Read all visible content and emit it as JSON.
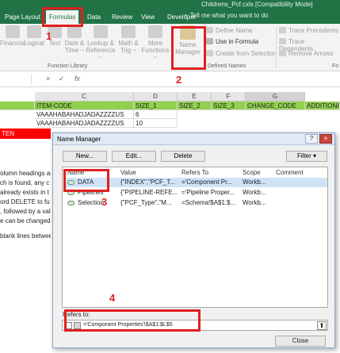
{
  "window": {
    "title": "Childrens_Pcf.cxls [Compatibility Mode]"
  },
  "ribbon": {
    "tabs": [
      "Page Layout",
      "Formulas",
      "Data",
      "Review",
      "View",
      "Developer"
    ],
    "active_tab": "Formulas",
    "tell_me": "Tell me what you want to do",
    "function_library": {
      "label": "Function Library",
      "items": [
        {
          "line1": "Financial",
          "line2": ""
        },
        {
          "line1": "Logical",
          "line2": ""
        },
        {
          "line1": "Text",
          "line2": ""
        },
        {
          "line1": "Date &",
          "line2": "Time ~"
        },
        {
          "line1": "Lookup &",
          "line2": "Reference ~"
        },
        {
          "line1": "Math &",
          "line2": "Trig ~"
        },
        {
          "line1": "More",
          "line2": "Functions ~"
        }
      ]
    },
    "defined_names": {
      "label": "Defined Names",
      "name_manager_line1": "Name",
      "name_manager_line2": "Manager",
      "define_name": "Define Name",
      "use_in_formula": "Use in Formula",
      "create_from_selection": "Create from Selection"
    },
    "formula_auditing": {
      "trace_precedents": "Trace Precedents",
      "trace_dependents": "Trace Dependents",
      "remove_arrows": "Remove Arrows"
    },
    "right_label": "Fo"
  },
  "formula_bar": {
    "fx": "fx",
    "cancel": "×",
    "enter": "✓"
  },
  "sheet": {
    "columns": [
      "C",
      "D",
      "E",
      "F",
      "G"
    ],
    "header_row": [
      "ITEM-CODE",
      "SIZE_1",
      "SIZE_2",
      "SIZE_3",
      "CHANGE_CODE",
      "ADDITIONA"
    ],
    "rows": [
      {
        "item": "VAAAHABAHADJADAZZZZUS",
        "size1": "6"
      },
      {
        "item": "VAAAHABAHADJADAZZZZUS",
        "size1": "10"
      }
    ],
    "red_text": "TEN",
    "left_lines": [
      "olumn headings as",
      "ch is found, any c",
      "already exists in t",
      "ord DELETE to fu",
      ", followed by a val",
      "e can be changed",
      "",
      "blank lines betwee"
    ]
  },
  "dialog": {
    "title": "Name Manager",
    "help": "?",
    "close": "×",
    "buttons": {
      "new": "New...",
      "edit": "Edit...",
      "delete": "Delete",
      "filter": "Filter"
    },
    "columns": [
      "Name",
      "Value",
      "Refers To",
      "Scope",
      "Comment"
    ],
    "rows": [
      {
        "name": "DATA",
        "value": "{\"INDEX\",\"PCF_T...",
        "refers_to": "='Component Pr...",
        "scope": "Workb..."
      },
      {
        "name": "Pipelines",
        "value": "{\"PIPELINE-REFE...",
        "refers_to": "='Pipeline Proper...",
        "scope": "Workb..."
      },
      {
        "name": "Selection",
        "value": "{\"PCF_Type\",\"M...",
        "refers_to": "=Schema!$A$1:$...",
        "scope": "Workb..."
      }
    ],
    "refers_to_label": "Refers to:",
    "refers_to_value": "='Component Properties'!$A$1:$L$5",
    "close_button": "Close"
  },
  "annotations": [
    "1",
    "2",
    "3",
    "4"
  ],
  "colors": {
    "excel_green": "#217346",
    "header_green": "#92d050",
    "annotation_red": "#e02020"
  }
}
